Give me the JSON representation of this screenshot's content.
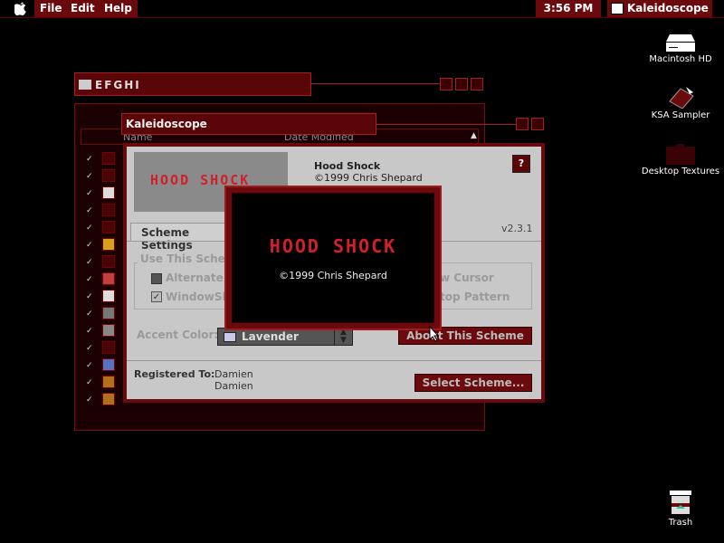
{
  "menubar": {
    "menus": [
      "File",
      "Edit",
      "Help"
    ],
    "clock": "3:56 PM",
    "app_name": "Kaleidoscope"
  },
  "desktop": {
    "icons": [
      {
        "label": "Macintosh HD",
        "icon": "hard-disk-icon"
      },
      {
        "label": "KSA Sampler",
        "icon": "ksa-sampler-icon"
      },
      {
        "label": "Desktop Textures",
        "icon": "folder-icon"
      },
      {
        "label": "Trash",
        "icon": "trash-icon"
      }
    ]
  },
  "finder_window": {
    "title": "EFGHI",
    "columns": {
      "name": "Name",
      "date": "Date Modified"
    }
  },
  "kaleidoscope": {
    "window_title": "Kaleidoscope",
    "scheme_name": "Hood Shock",
    "scheme_copyright": "©1999 Chris Shepard",
    "version": "v2.3.1",
    "tab_label": "Scheme Settings",
    "group_label": "Use This Scheme",
    "option_alternate": "Alternate",
    "option_windowshade": "WindowSh",
    "option_cursor": "w Cursor",
    "option_pattern": "top Pattern",
    "accent_label": "Accent Color:",
    "accent_value": "Lavender",
    "about_button": "About This Scheme",
    "registered_label": "Registered To:",
    "registered_name": "Damien",
    "registered_org": "Damien",
    "select_button": "Select Scheme..."
  },
  "about_dialog": {
    "logo": "HOOD SHOCK",
    "copyright": "©1999 Chris Shepard"
  },
  "colors": {
    "accent": "#6a0a0c",
    "logo": "#d0202a"
  }
}
